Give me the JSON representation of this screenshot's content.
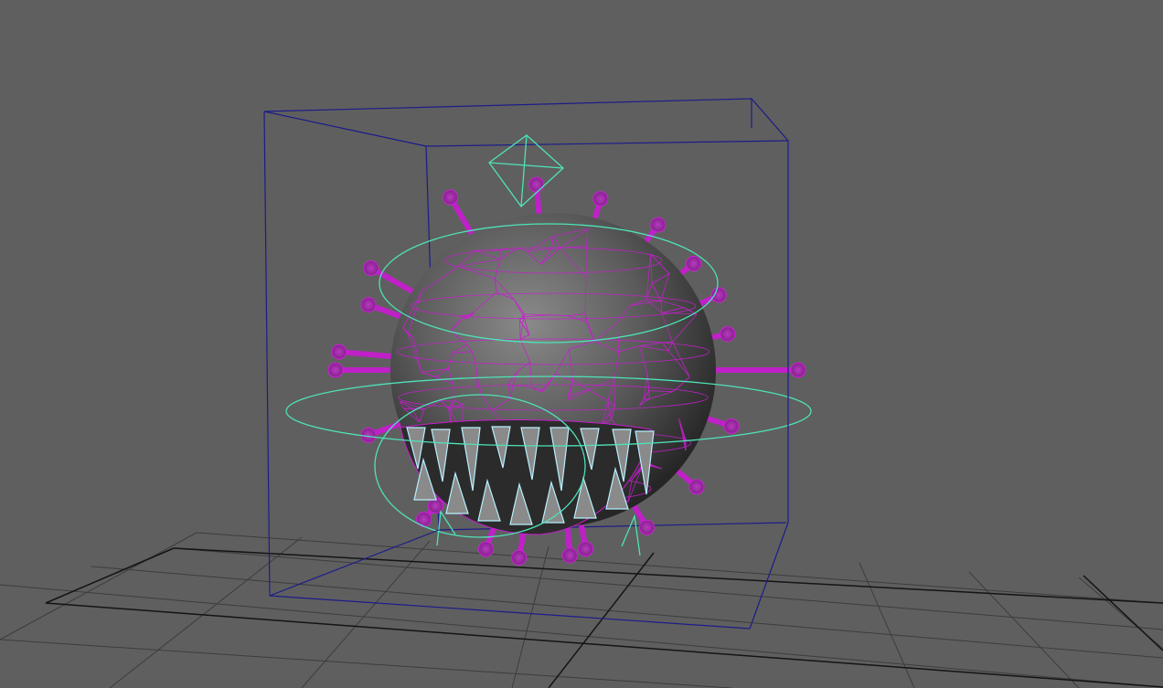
{
  "viewport": {
    "background": "#5f5f5f",
    "grid_color": "#3c3c3c",
    "grid_axis_color": "#111111"
  },
  "selection": {
    "bounding_box_color": "#1c1c8a",
    "object_wire_color": "#d020d8",
    "rig_control_color": "#4fe2b8"
  },
  "icons": {
    "head_control": "diamond-control-icon",
    "body_control": "circle-control-icon",
    "teeth_controls": "cone-control-icon"
  }
}
